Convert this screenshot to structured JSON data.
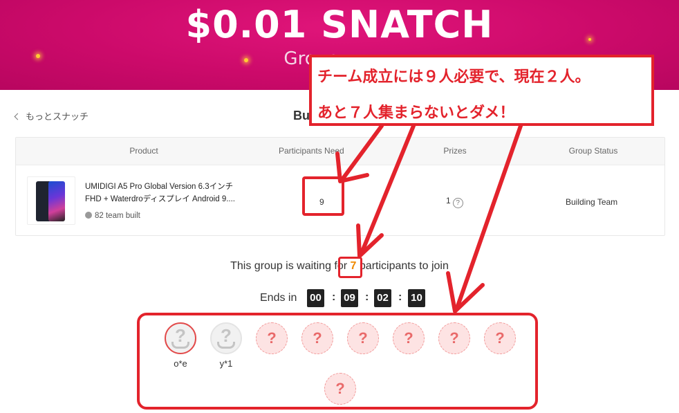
{
  "banner": {
    "title": "$0.01 SNATCH",
    "subtitle": "Group"
  },
  "nav": {
    "back_label": "もっとスナッチ",
    "heading": "Bu"
  },
  "table": {
    "headers": [
      "Product",
      "Participants Need",
      "Prizes",
      "Group Status"
    ],
    "row": {
      "product_name": "UMIDIGI A5 Pro Global Version 6.3インチ FHD + Waterdroディスプレイ Android 9....",
      "team_built": "82 team built",
      "participants_need": "9",
      "prizes": "1",
      "prizes_help": "?",
      "group_status": "Building Team"
    }
  },
  "waiting": {
    "prefix": "This group is waiting for",
    "count": "7",
    "suffix": "participants to join"
  },
  "countdown": {
    "label": "Ends in",
    "hours": "00",
    "minutes": "09",
    "seconds": "02",
    "centis": "10",
    "sep": ":"
  },
  "members": [
    {
      "name": "o*e",
      "state": "joined",
      "role": "leader"
    },
    {
      "name": "y*1",
      "state": "joined",
      "role": "member"
    }
  ],
  "empty_slot_symbol": "?",
  "annotation": {
    "line1": "チーム成立には９人必要で、現在２人。",
    "line2": "あと７人集まらないとダメ！"
  },
  "colors": {
    "banner": "#cc0a6a",
    "annotation_red": "#e3232c",
    "waiting_count": "#f08a00",
    "empty_slot": "#fde3e3"
  }
}
